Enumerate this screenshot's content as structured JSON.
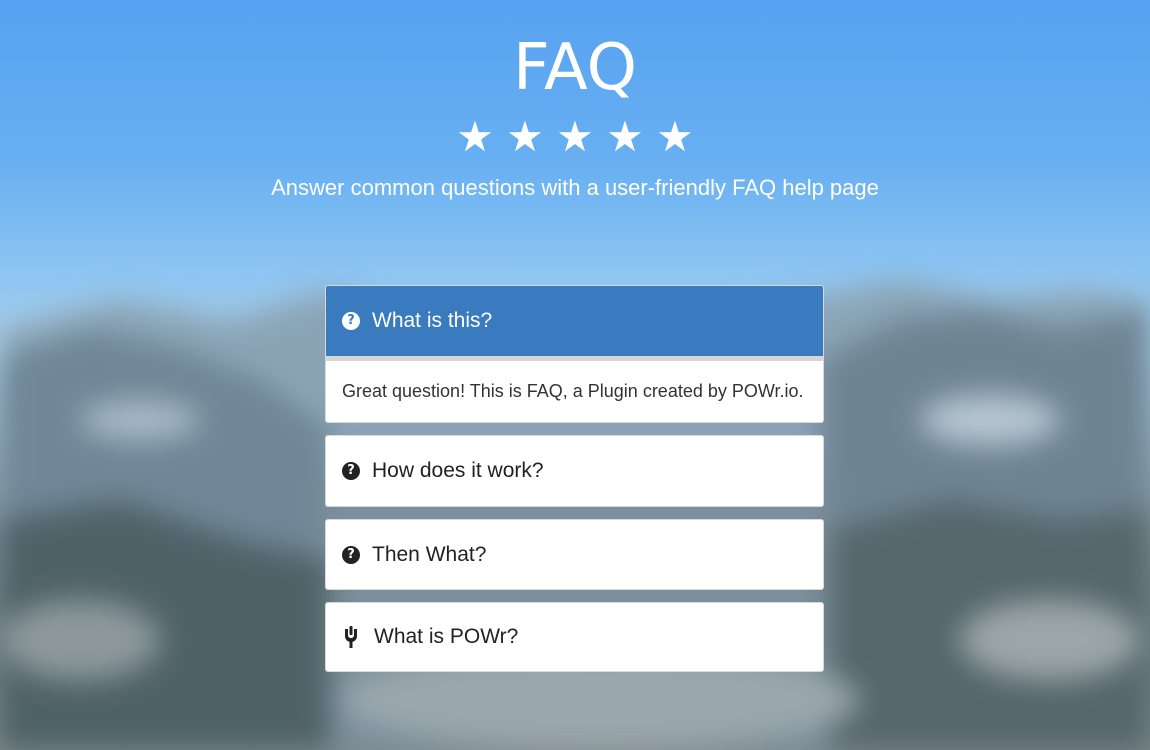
{
  "header": {
    "title": "FAQ",
    "stars": [
      "★",
      "★",
      "★",
      "★",
      "★"
    ],
    "rating": 5,
    "subtitle": "Answer common questions with a user-friendly FAQ help page"
  },
  "faq": {
    "items": [
      {
        "question": "What is this?",
        "answer": "Great question! This is FAQ, a Plugin created by POWr.io.",
        "icon": "question-circle-icon",
        "expanded": true
      },
      {
        "question": "How does it work?",
        "icon": "question-circle-icon",
        "expanded": false
      },
      {
        "question": "Then What?",
        "icon": "question-circle-icon",
        "expanded": false
      },
      {
        "question": "What is POWr?",
        "icon": "power-plug-icon",
        "expanded": false
      }
    ]
  },
  "colors": {
    "accent": "#3a7abf",
    "text_on_accent": "#ffffff",
    "card_bg": "#ffffff",
    "sky": "#5ea6ef"
  }
}
